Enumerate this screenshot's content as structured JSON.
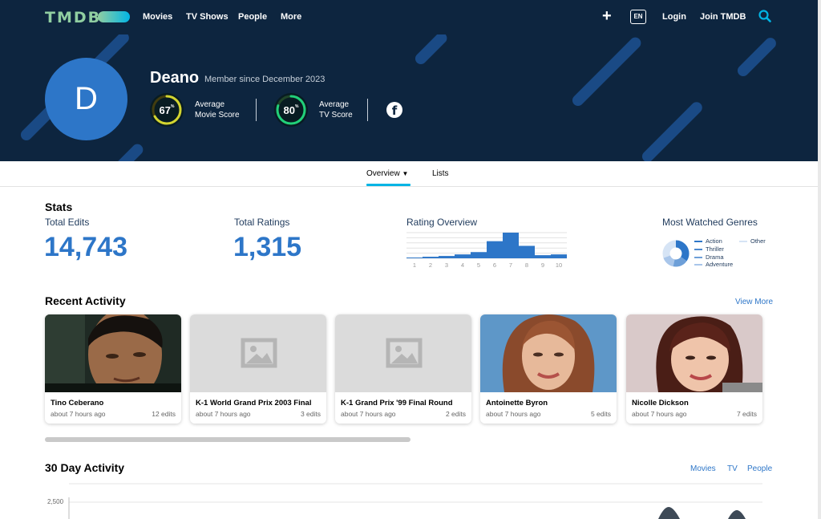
{
  "nav": {
    "logo": "TMDB",
    "items": [
      "Movies",
      "TV Shows",
      "People",
      "More"
    ],
    "lang": "EN",
    "login": "Login",
    "join": "Join TMDB",
    "icons": [
      "plus-icon",
      "search-icon"
    ]
  },
  "profile": {
    "initial": "D",
    "name": "Deano",
    "member_since": "Member since December 2023",
    "movie_score": {
      "value": "67",
      "unit": "%",
      "label_line1": "Average",
      "label_line2": "Movie Score",
      "fraction": 0.67,
      "color": "#d2d531"
    },
    "tv_score": {
      "value": "80",
      "unit": "%",
      "label_line1": "Average",
      "label_line2": "TV Score",
      "fraction": 0.8,
      "color": "#21d07a"
    },
    "social_icon": "facebook-icon"
  },
  "tabs": {
    "overview": "Overview",
    "lists": "Lists"
  },
  "stats": {
    "heading": "Stats",
    "total_edits_label": "Total Edits",
    "total_edits": "14,743",
    "total_ratings_label": "Total Ratings",
    "total_ratings": "1,315",
    "rating_overview_label": "Rating Overview",
    "most_watched_label": "Most Watched Genres",
    "genres": [
      "Action",
      "Thriller",
      "Drama",
      "Adventure",
      "Other"
    ]
  },
  "chart_data": {
    "type": "bar",
    "title": "Rating Overview",
    "categories": [
      "1",
      "2",
      "3",
      "4",
      "5",
      "6",
      "7",
      "8",
      "9",
      "10"
    ],
    "values": [
      1,
      2,
      3,
      5,
      8,
      22,
      33,
      16,
      4,
      5
    ]
  },
  "recent": {
    "heading": "Recent Activity",
    "view_more": "View More",
    "cards": [
      {
        "title": "Tino Ceberano",
        "time": "about 7 hours ago",
        "edits": "12 edits"
      },
      {
        "title": "K-1 World Grand Prix 2003 Final",
        "time": "about 7 hours ago",
        "edits": "3 edits"
      },
      {
        "title": "K-1 Grand Prix '99 Final Round",
        "time": "about 7 hours ago",
        "edits": "2 edits"
      },
      {
        "title": "Antoinette Byron",
        "time": "about 7 hours ago",
        "edits": "5 edits"
      },
      {
        "title": "Nicolle Dickson",
        "time": "about 7 hours ago",
        "edits": "7 edits"
      }
    ]
  },
  "activity": {
    "heading": "30 Day Activity",
    "filters": [
      "Movies",
      "TV",
      "People"
    ],
    "y_tick": "2,500"
  },
  "colors": {
    "navy": "#0d253f",
    "accent": "#2d76c8",
    "teal": "#01b4e4"
  }
}
